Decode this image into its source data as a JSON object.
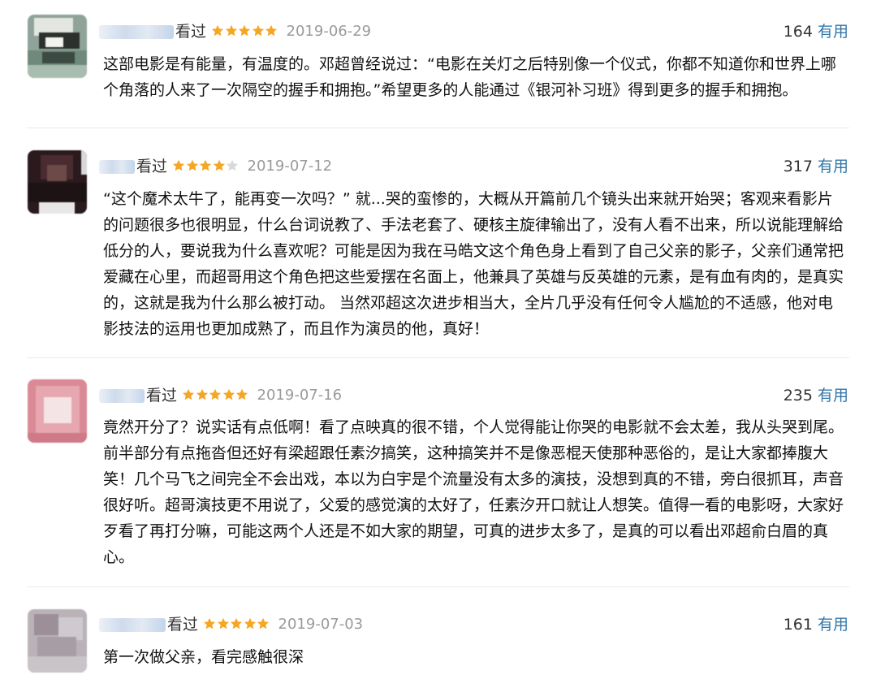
{
  "reviews": [
    {
      "watched_label": "看过",
      "rating": 5,
      "date": "2019-06-29",
      "useful_count": "164",
      "useful_label": "有用",
      "content": "这部电影是有能量，有温度的。邓超曾经说过：“电影在关灯之后特别像一个仪式，你都不知道你和世界上哪个角落的人来了一次隔空的握手和拥抱。”希望更多的人能通过《银河补习班》得到更多的握手和拥抱。"
    },
    {
      "watched_label": "看过",
      "rating": 4,
      "date": "2019-07-12",
      "useful_count": "317",
      "useful_label": "有用",
      "content": "“这个魔术太牛了，能再变一次吗？” 就...哭的蛮惨的，大概从开篇前几个镜头出来就开始哭；客观来看影片的问题很多也很明显，什么台词说教了、手法老套了、硬核主旋律输出了，没有人看不出来，所以说能理解给低分的人，要说我为什么喜欢呢？可能是因为我在马皓文这个角色身上看到了自己父亲的影子，父亲们通常把爱藏在心里，而超哥用这个角色把这些爱摆在名面上，他兼具了英雄与反英雄的元素，是有血有肉的，是真实的，这就是我为什么那么被打动。 当然邓超这次进步相当大，全片几乎没有任何令人尴尬的不适感，他对电影技法的运用也更加成熟了，而且作为演员的他，真好！"
    },
    {
      "watched_label": "看过",
      "rating": 5,
      "date": "2019-07-16",
      "useful_count": "235",
      "useful_label": "有用",
      "content": "竟然开分了？说实话有点低啊！看了点映真的很不错，个人觉得能让你哭的电影就不会太差，我从头哭到尾。前半部分有点拖沓但还好有梁超跟任素汐搞笑，这种搞笑并不是像恶棍天使那种恶俗的，是让大家都捧腹大笑！几个马飞之间完全不会出戏，本以为白宇是个流量没有太多的演技，没想到真的不错，旁白很抓耳，声音很好听。超哥演技更不用说了，父爱的感觉演的太好了，任素汐开口就让人想笑。值得一看的电影呀，大家好歹看了再打分嘛，可能这两个人还是不如大家的期望，可真的进步太多了，是真的可以看出邓超俞白眉的真心。"
    },
    {
      "watched_label": "看过",
      "rating": 5,
      "date": "2019-07-03",
      "useful_count": "161",
      "useful_label": "有用",
      "content": "第一次做父亲，看完感触很深"
    }
  ],
  "colors": {
    "star_filled": "#f5a623",
    "star_empty": "#d9d9d9",
    "useful_link": "#3377aa",
    "date_text": "#9a9a9a"
  }
}
